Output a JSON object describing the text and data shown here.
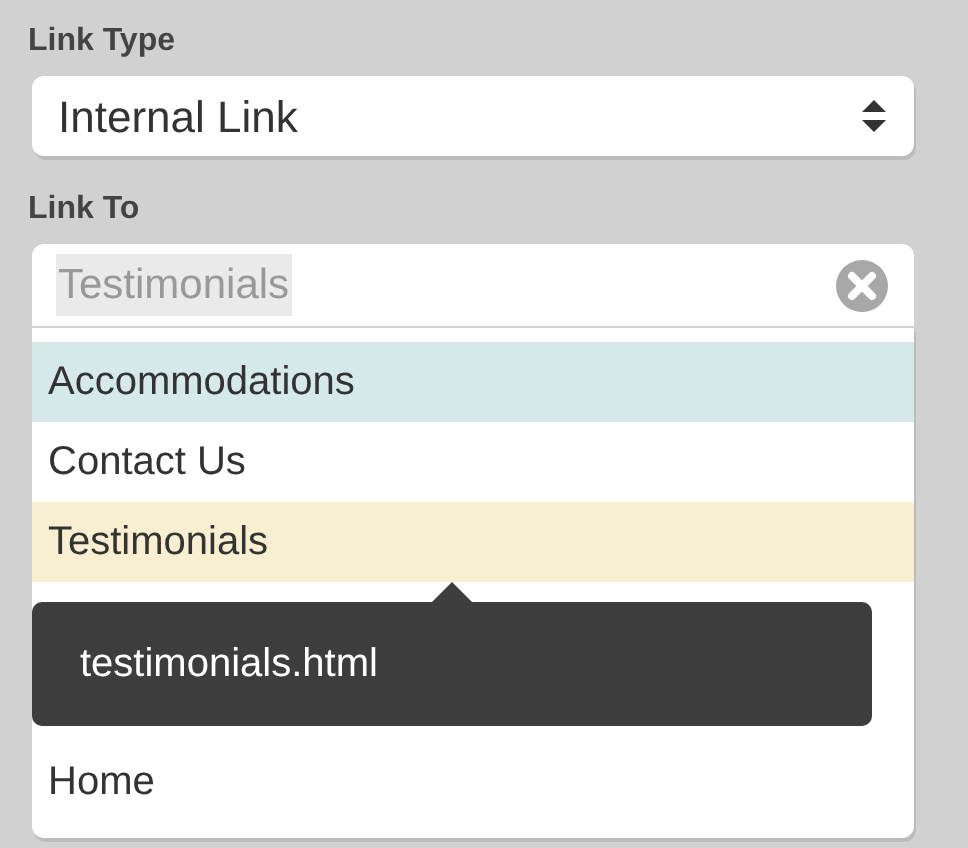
{
  "link_type": {
    "label": "Link Type",
    "value": "Internal Link"
  },
  "link_to": {
    "label": "Link To",
    "value": "Testimonials"
  },
  "options": [
    {
      "label": "Accommodations",
      "highlighted": true,
      "selected": false
    },
    {
      "label": "Contact Us",
      "highlighted": false,
      "selected": false
    },
    {
      "label": "Testimonials",
      "highlighted": false,
      "selected": true
    },
    {
      "label": "Home",
      "highlighted": false,
      "selected": false
    }
  ],
  "tooltip": {
    "text": "testimonials.html"
  }
}
